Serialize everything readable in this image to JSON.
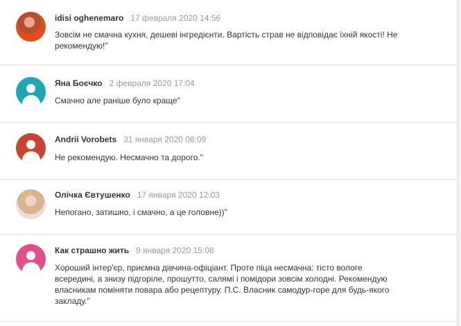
{
  "colors": {
    "avatar_teal": "#1fa6b6",
    "avatar_red": "#c74631",
    "avatar_pink": "#e34f8c"
  },
  "reviews": [
    {
      "author": "idisi oghenemaro",
      "date": "17 февраля 2020 14:56",
      "text": "Зовсім не смачна кухня, дешеві інгредієнти. Вартість страв не відповідає їхній якості! Не рекомендую!\""
    },
    {
      "author": "Яна Боєчко",
      "date": "2 февраля 2020 17:04",
      "text": "Смачно але раніше було краще\""
    },
    {
      "author": "Andrii Vorobets",
      "date": "31 января 2020 08:09",
      "text": "Не рекомендую. Несмачно та дорого.\""
    },
    {
      "author": "Олічка Євтушенко",
      "date": "17 января 2020 12:03",
      "text": "Непогано, затишно, і смачно, а це головне))\""
    },
    {
      "author": "Как страшно жить",
      "date": "9 января 2020 15:08",
      "text": "Хороший інтер'єр, приємна дівчина-офіціант. Проте піца несмачна: тісто вологе всередині, а знизу підгоріле, прошутто, салямі і помідори зовсім холодні. Рекомендую власникам поміняти повара або рецептуру. П.С. Власник самодур-горе для будь-якого закладу.\""
    }
  ]
}
